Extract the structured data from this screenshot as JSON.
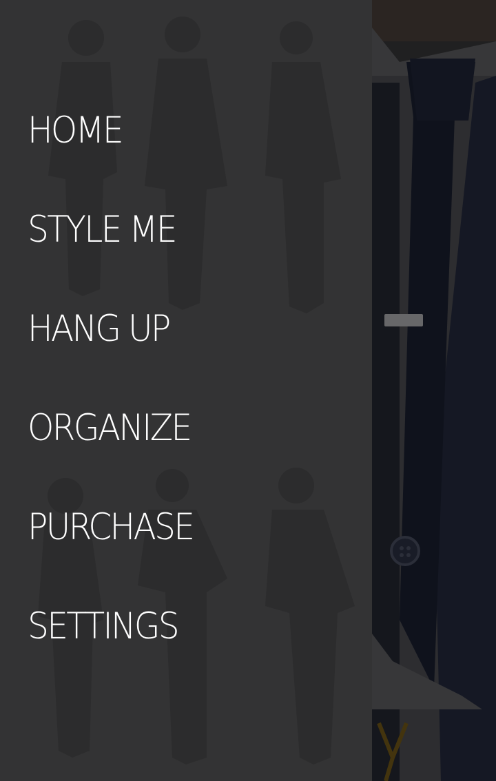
{
  "drawer": {
    "items": [
      {
        "label": "HOME"
      },
      {
        "label": "STYLE ME"
      },
      {
        "label": "HANG UP"
      },
      {
        "label": "ORGANIZE"
      },
      {
        "label": "PURCHASE"
      },
      {
        "label": "SETTINGS"
      }
    ]
  },
  "colors": {
    "drawer_bg": "#333334",
    "menu_text": "#ffffff",
    "accent_gold": "#6b5418"
  }
}
